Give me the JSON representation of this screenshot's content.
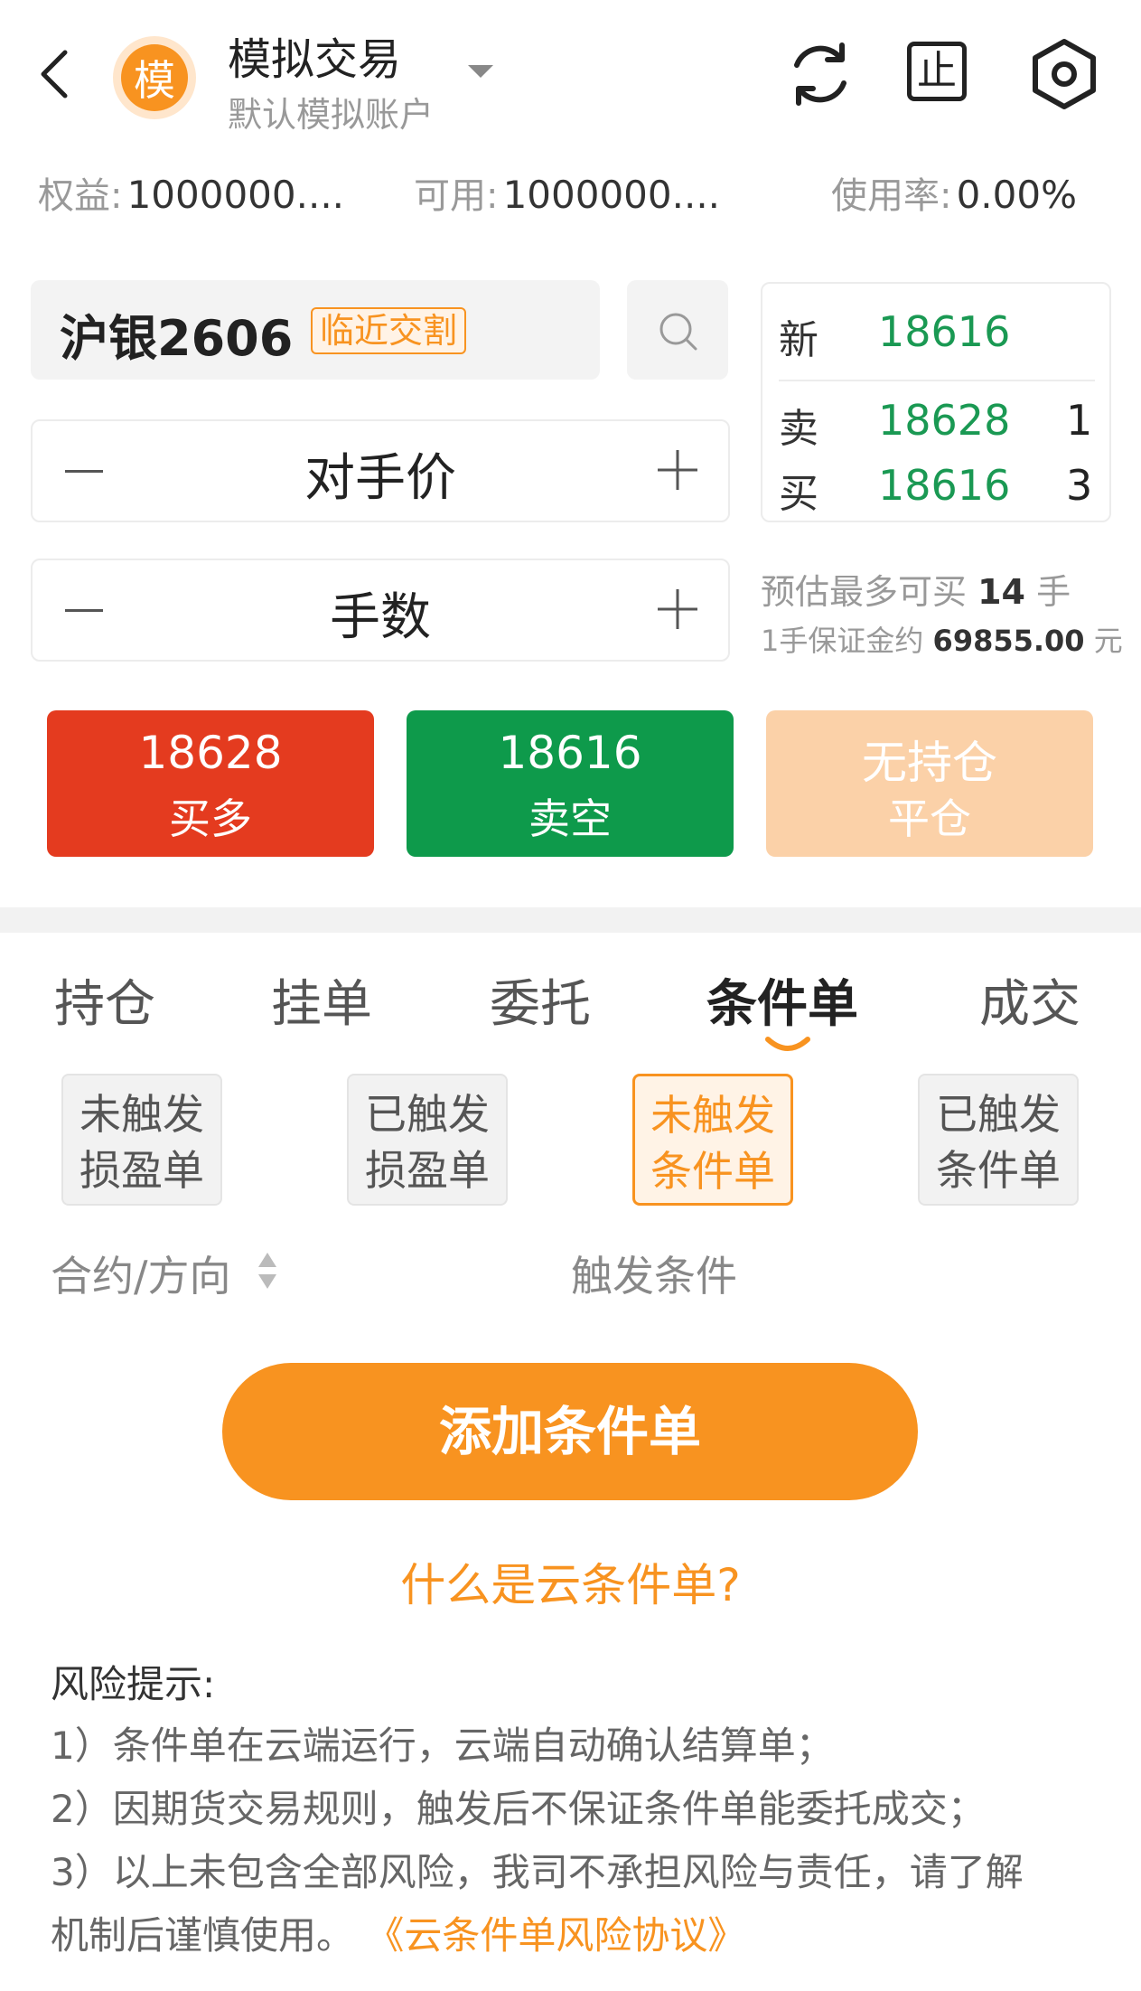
{
  "header": {
    "avatar_text": "模",
    "title": "模拟交易",
    "subtitle": "默认模拟账户",
    "stop_icon_text": "止"
  },
  "stats": {
    "equity_label": "权益:",
    "equity_value": "1000000....",
    "available_label": "可用:",
    "available_value": "1000000....",
    "usage_label": "使用率:",
    "usage_value": "0.00%"
  },
  "contract": {
    "name": "沪银2606",
    "badge": "临近交割"
  },
  "price_stepper": {
    "label": "对手价"
  },
  "qty_stepper": {
    "label": "手数"
  },
  "quote": {
    "latest_label": "新",
    "latest_price": "18616",
    "ask_label": "卖",
    "ask_price": "18628",
    "ask_volume": "1",
    "bid_label": "买",
    "bid_price": "18616",
    "bid_volume": "3"
  },
  "estimate": {
    "max_buy_prefix": "预估最多可买",
    "max_buy_value": "14",
    "max_buy_unit": "手",
    "margin_prefix": "1手保证金约",
    "margin_value": "69855.00",
    "margin_unit": "元"
  },
  "actions": {
    "buy_price": "18628",
    "buy_label": "买多",
    "sell_price": "18616",
    "sell_label": "卖空",
    "close_top": "无持仓",
    "close_label": "平仓"
  },
  "tabs": [
    "持仓",
    "挂单",
    "委托",
    "条件单",
    "成交"
  ],
  "active_tab_index": 3,
  "subtabs": [
    {
      "line1": "未触发",
      "line2": "损盈单"
    },
    {
      "line1": "已触发",
      "line2": "损盈单"
    },
    {
      "line1": "未触发",
      "line2": "条件单"
    },
    {
      "line1": "已触发",
      "line2": "条件单"
    }
  ],
  "active_subtab_index": 2,
  "table_header": {
    "col1": "合约/方向",
    "col2": "触发条件"
  },
  "add_button": "添加条件单",
  "what_link": "什么是云条件单?",
  "risk": {
    "title": "风险提示:",
    "line1": "1）条件单在云端运行，云端自动确认结算单；",
    "line2": "2）因期货交易规则，触发后不保证条件单能委托成交；",
    "line3": "3）以上未包含全部风险，我司不承担风险与责任，请了解",
    "line4": "机制后谨慎使用。",
    "agreement_link": "《云条件单风险协议》"
  },
  "colors": {
    "accent": "#f89320",
    "buy": "#e43b1f",
    "sell": "#0e9a4b",
    "close_disabled": "#fbd1a8",
    "price_green": "#1a9953"
  }
}
